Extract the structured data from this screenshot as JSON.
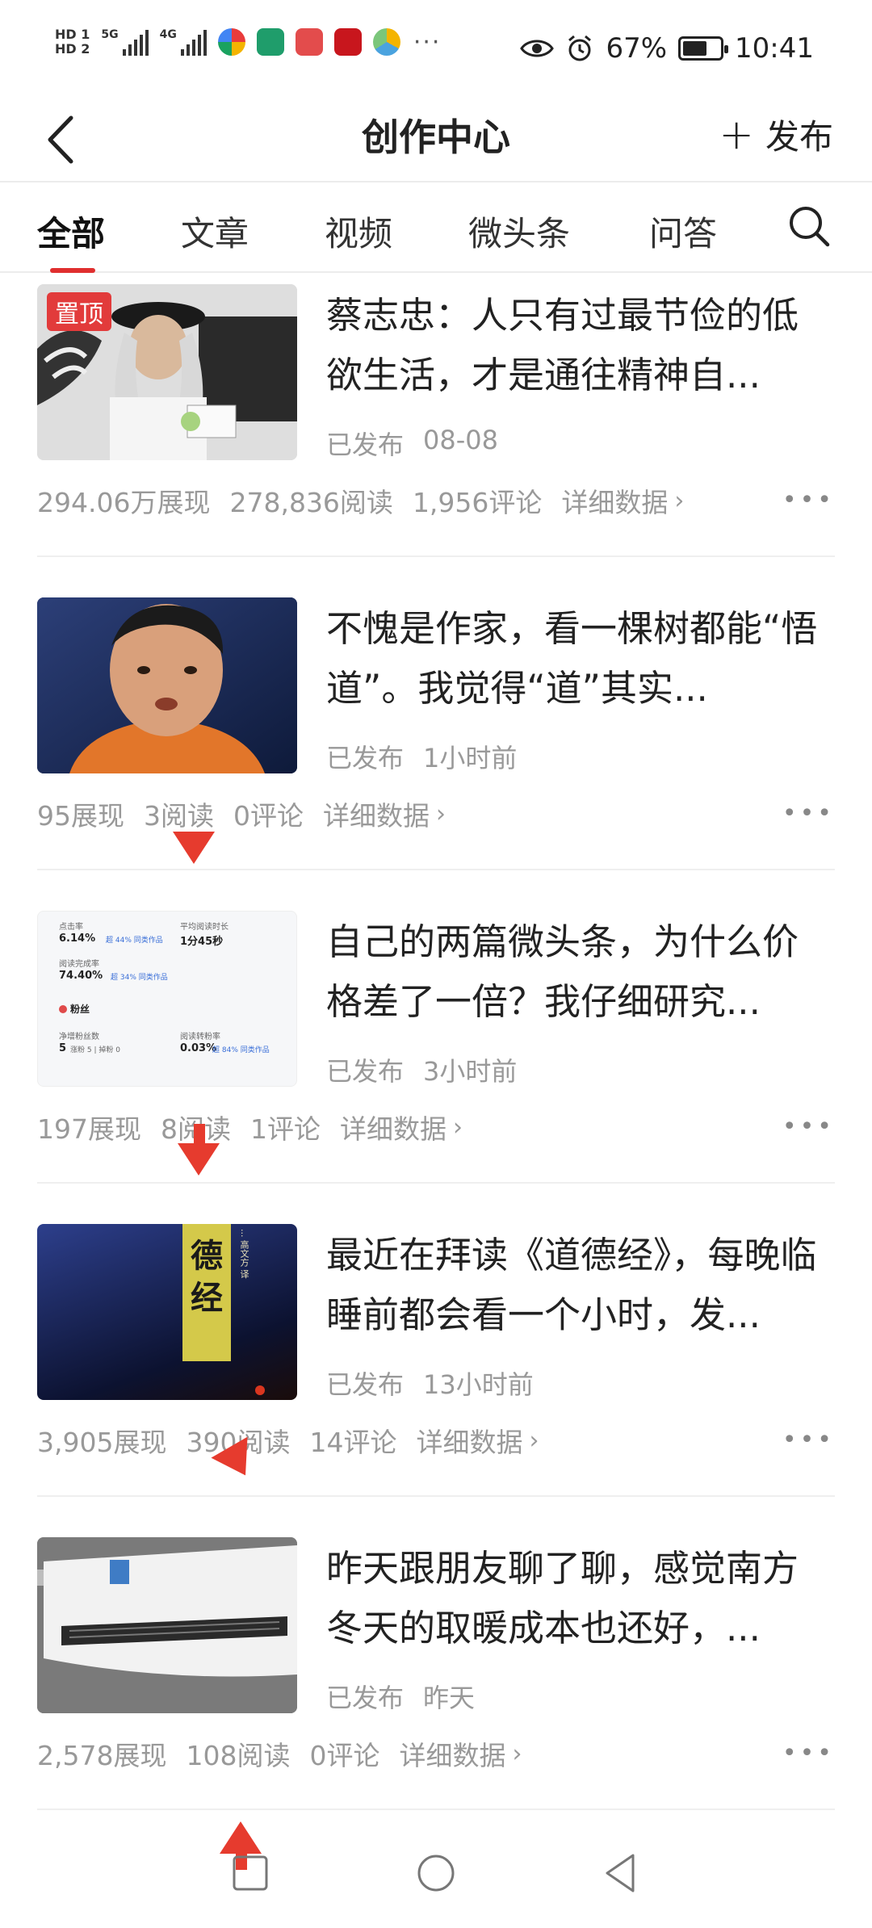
{
  "status_bar": {
    "hd1": "HD 1",
    "hd2": "HD 2",
    "net1": "5G",
    "net2": "4G",
    "more_dots": "···",
    "battery_text": "67%",
    "battery_level": 0.67,
    "time": "10:41"
  },
  "header": {
    "title": "创作中心",
    "publish_label": "发布"
  },
  "tabs": [
    {
      "label": "全部",
      "active": true
    },
    {
      "label": "文章",
      "active": false
    },
    {
      "label": "视频",
      "active": false
    },
    {
      "label": "微头条",
      "active": false
    },
    {
      "label": "问答",
      "active": false
    }
  ],
  "pinned_label": "置顶",
  "items": [
    {
      "title": "蔡志忠：人只有过最节俭的低欲生活，才是通往精神自...",
      "status": "已发布",
      "time": "08-08",
      "views": "294.06万展现",
      "reads": "278,836阅读",
      "comments": "1,956评论",
      "detail": "详细数据",
      "pinned": true
    },
    {
      "title": "不愧是作家，看一棵树都能“悟道”。我觉得“道”其实...",
      "status": "已发布",
      "time": "1小时前",
      "views": "95展现",
      "reads": "3阅读",
      "comments": "0评论",
      "detail": "详细数据"
    },
    {
      "title": "自己的两篇微头条，为什么价格差了一倍？我仔细研究...",
      "status": "已发布",
      "time": "3小时前",
      "views": "197展现",
      "reads": "8阅读",
      "comments": "1评论",
      "detail": "详细数据"
    },
    {
      "title": "最近在拜读《道德经》，每晚临睡前都会看一个小时，发...",
      "status": "已发布",
      "time": "13小时前",
      "views": "3,905展现",
      "reads": "390阅读",
      "comments": "14评论",
      "detail": "详细数据"
    },
    {
      "title": "昨天跟朋友聊了聊，感觉南方冬天的取暖成本也还好，...",
      "status": "已发布",
      "time": "昨天",
      "views": "2,578展现",
      "reads": "108阅读",
      "comments": "0评论",
      "detail": "详细数据"
    }
  ],
  "thumb3": {
    "label1": "点击率",
    "val1": "6.14%",
    "tag1": "超 44% 同类作品",
    "label2": "平均阅读时长",
    "val2": "1分45秒",
    "label3": "阅读完成率",
    "val3": "74.40%",
    "tag3": "超 34% 同类作品",
    "section": "粉丝",
    "label4": "净增粉丝数",
    "val4": "5",
    "sub4": "涨粉 5 | 掉粉 0",
    "label5": "阅读转粉率",
    "val5": "0.03%",
    "tag5": "超 84% 同类作品"
  },
  "thumb4": {
    "book_text": "德经",
    "book_side": "... 高文方 译"
  }
}
